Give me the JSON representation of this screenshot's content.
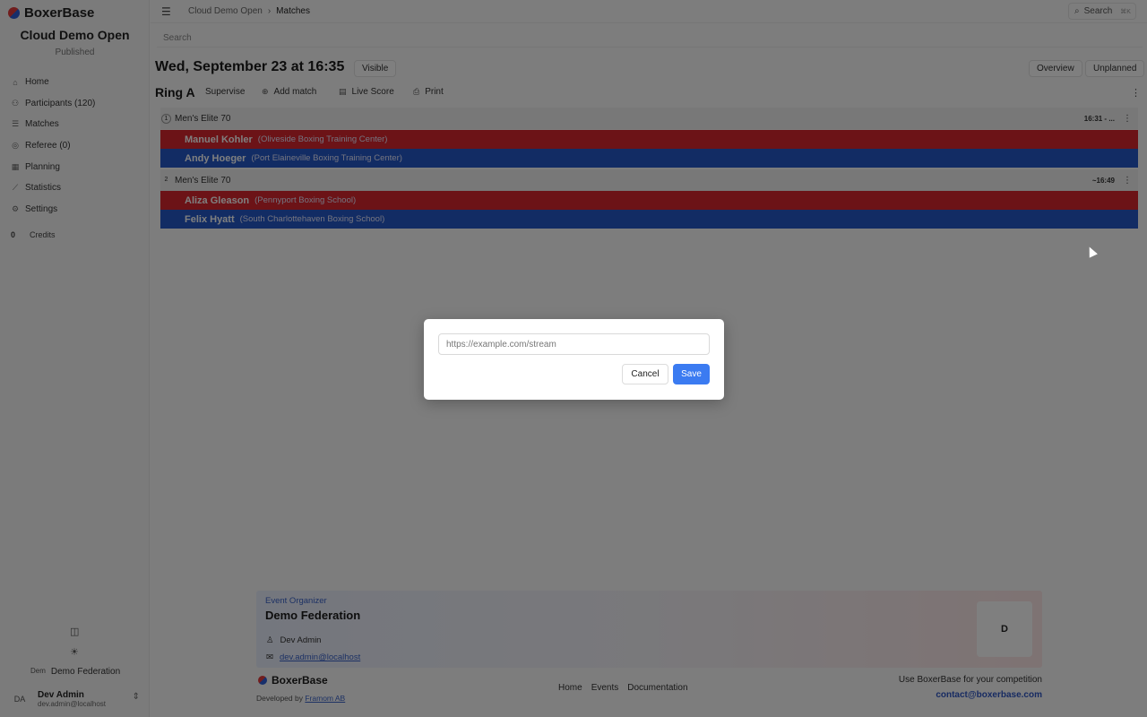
{
  "brand": {
    "name": "BoxerBase"
  },
  "event": {
    "title": "Cloud Demo Open",
    "status": "Published"
  },
  "nav": [
    {
      "label": "Home",
      "icon": "home-icon",
      "glyph": "⌂"
    },
    {
      "label": "Participants (120)",
      "icon": "participants-icon",
      "glyph": "⚇"
    },
    {
      "label": "Matches",
      "icon": "list-icon",
      "glyph": "☰"
    },
    {
      "label": "Referee (0)",
      "icon": "referee-icon",
      "glyph": "◎"
    },
    {
      "label": "Planning",
      "icon": "calendar-icon",
      "glyph": "▦"
    },
    {
      "label": "Statistics",
      "icon": "chart-icon",
      "glyph": "⟋"
    },
    {
      "label": "Settings",
      "icon": "gear-icon",
      "glyph": "⚙"
    }
  ],
  "credits": {
    "count": "0",
    "label": "Credits"
  },
  "sidebar_footer": {
    "org_abbrev": "Dem",
    "org_name": "Demo Federation",
    "user_initials": "DA",
    "user_name": "Dev Admin",
    "user_email": "dev.admin@localhost"
  },
  "topbar": {
    "breadcrumb": [
      "Cloud Demo Open",
      "Matches"
    ],
    "search_label": "Search",
    "search_shortcut": "⌘K"
  },
  "search": {
    "placeholder": "Search"
  },
  "schedule": {
    "date_title": "Wed, September 23 at 16:35",
    "visibility": "Visible",
    "overview": "Overview",
    "unplanned": "Unplanned"
  },
  "ring": {
    "title": "Ring A",
    "actions": {
      "supervise": "Supervise",
      "add_match": "Add match",
      "live_score": "Live Score",
      "print": "Print"
    }
  },
  "matches": [
    {
      "number": "1",
      "category": "Men's Elite 70",
      "time": "16:31 - ...",
      "red": {
        "name": "Manuel Kohler",
        "club": "(Oliveside Boxing Training Center)"
      },
      "blue": {
        "name": "Andy Hoeger",
        "club": "(Port Elaineville Boxing Training Center)"
      }
    },
    {
      "number": "2",
      "category": "Men's Elite 70",
      "time": "~16:49",
      "red": {
        "name": "Aliza Gleason",
        "club": "(Pennyport Boxing School)"
      },
      "blue": {
        "name": "Felix Hyatt",
        "club": "(South Charlottehaven Boxing School)"
      }
    }
  ],
  "organizer": {
    "label": "Event Organizer",
    "name": "Demo Federation",
    "contact_name": "Dev Admin",
    "contact_email": "dev.admin@localhost",
    "logo_letter": "D"
  },
  "footer": {
    "brand": "BoxerBase",
    "developed_by": "Developed by",
    "developer": "Framom AB",
    "links": [
      "Home",
      "Events",
      "Documentation"
    ],
    "cta": "Use BoxerBase for your competition",
    "contact": "contact@boxerbase.com"
  },
  "dialog": {
    "input_value": "",
    "input_placeholder": "https://example.com/stream",
    "cancel": "Cancel",
    "save": "Save"
  }
}
